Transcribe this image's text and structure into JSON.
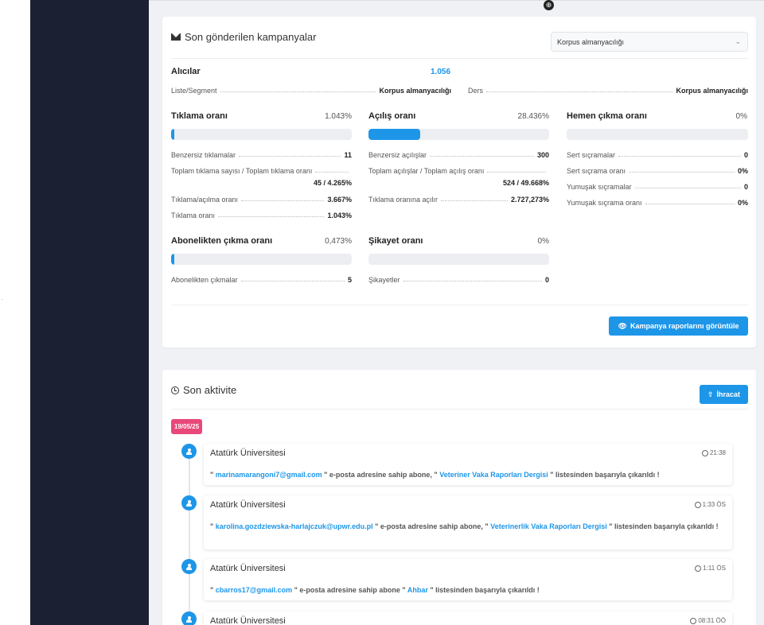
{
  "campaign_card": {
    "title": "Son gönderilen kampanyalar",
    "select_value": "Korpus almanyacılığı",
    "recipients_label": "Alıcılar",
    "recipients_value": "1.056",
    "list_label": "Liste/Segment",
    "list_value": "Korpus almanyacılığı",
    "subject_label": "Ders",
    "subject_value": "Korpus almanyacılığı",
    "click_rate": {
      "label": "Tıklama oranı",
      "value": "1.043%",
      "fill_percent": 1.043,
      "rows": [
        {
          "label": "Benzersiz tıklamalar",
          "value": "11"
        },
        {
          "label": "Toplam tıklama sayısı / Toplam tıklama oranı",
          "value": "45 / 4.265%"
        },
        {
          "label": "Tıklama/açılma oranı",
          "value": "3.667%"
        },
        {
          "label": "Tıklama oranı",
          "value": "1.043%"
        }
      ]
    },
    "open_rate": {
      "label": "Açılış oranı",
      "value": "28.436%",
      "fill_percent": 28.436,
      "rows": [
        {
          "label": "Benzersiz açılışlar",
          "value": "300"
        },
        {
          "label": "Toplam açılışlar / Toplam açılış oranı",
          "value": "524 / 49.668%"
        },
        {
          "label": "Tıklama oranına açılır",
          "value": "2.727,273%"
        }
      ]
    },
    "bounce_rate": {
      "label": "Hemen çıkma oranı",
      "value": "0%",
      "fill_percent": 0,
      "rows": [
        {
          "label": "Sert sıçramalar",
          "value": "0"
        },
        {
          "label": "Sert sıçrama oranı",
          "value": "0%"
        },
        {
          "label": "Yumuşak sıçramalar",
          "value": "0"
        },
        {
          "label": "Yumuşak sıçrama oranı",
          "value": "0%"
        }
      ]
    },
    "unsub_rate": {
      "label": "Abonelikten çıkma oranı",
      "value": "0,473%",
      "fill_percent": 0.473,
      "rows": [
        {
          "label": "Abonelikten çıkmalar",
          "value": "5"
        }
      ]
    },
    "complaint_rate": {
      "label": "Şikayet oranı",
      "value": "0%",
      "fill_percent": 0,
      "rows": [
        {
          "label": "Şikayetler",
          "value": "0"
        }
      ]
    },
    "report_button": "Kampanya raporlarını görüntüle"
  },
  "activity_card": {
    "title": "Son aktivite",
    "export_button": "İhracat",
    "date_badge": "19/05/25",
    "items": [
      {
        "source": "Atatürk Üniversitesi",
        "time": "21:38",
        "q1": "\" ",
        "email": "marinamarangoni7@gmail.com",
        "mid": " \" e-posta adresine sahip abone, \" ",
        "list": "Veteriner Vaka Raporları Dergisi",
        "end": " \" listesinden başarıyla çıkarıldı !"
      },
      {
        "source": "Atatürk Üniversitesi",
        "time": "1:33 ÖS",
        "q1": "\" ",
        "email": "karolina.gozdziewska-harlajczuk@upwr.edu.pl",
        "mid": " \" e-posta adresine sahip abone, \" ",
        "list": "Veterinerlik Vaka Raporları Dergisi",
        "end": " \" listesinden başarıyla çıkarıldı !"
      },
      {
        "source": "Atatürk Üniversitesi",
        "time": "1:11 ÖS",
        "q1": "\" ",
        "email": "cbarros17@gmail.com",
        "mid": " \" e-posta adresine sahip abone \" ",
        "list": "Ahbar",
        "end": " \" listesinden başarıyla çıkarıldı !"
      },
      {
        "source": "Atatürk Üniversitesi",
        "time": "08:31 ÖÖ"
      }
    ]
  },
  "colors": {
    "accent": "#1d96e8",
    "sidebar": "#1b2033",
    "badge": "#e8487a"
  }
}
